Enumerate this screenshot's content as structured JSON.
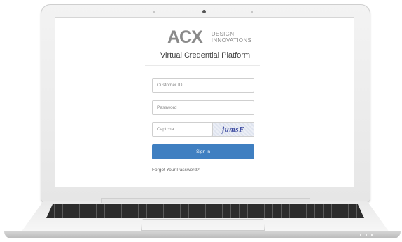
{
  "brand": {
    "logo_mark": "ACX",
    "logo_sub_line1": "DESIGN",
    "logo_sub_line2": "INNOVATIONS"
  },
  "page": {
    "title": "Virtual Credential Platform"
  },
  "form": {
    "customer_id_placeholder": "Customer ID",
    "password_placeholder": "Password",
    "captcha_placeholder": "Captcha",
    "captcha_code": "jumsF",
    "signin_label": "Sign in",
    "forgot_label": "Forgot Your Password?"
  },
  "colors": {
    "accent": "#3f7fc1",
    "logo_gray": "#8a8a8a"
  }
}
